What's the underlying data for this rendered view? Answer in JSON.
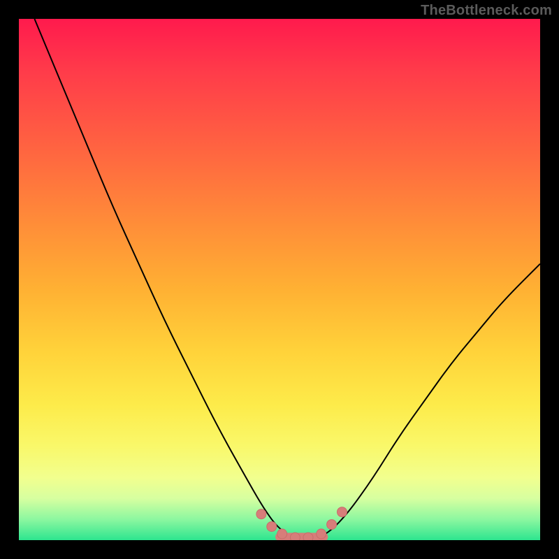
{
  "source_label": "TheBottleneck.com",
  "colors": {
    "curve_stroke": "#000000",
    "marker_fill": "#d77d7a",
    "marker_stroke": "#c96d6a"
  },
  "chart_data": {
    "type": "line",
    "title": "",
    "xlabel": "",
    "ylabel": "",
    "xlim": [
      0,
      1
    ],
    "ylim": [
      0,
      100
    ],
    "note": "y = bottleneck percentage; curve minimum (≈0% bottleneck) lies around x≈0.50–0.58; left branch starts near 100% at x≈0.03; right branch reaches ≈53% at x=1.0.",
    "series": [
      {
        "name": "bottleneck-curve",
        "x": [
          0.03,
          0.08,
          0.13,
          0.18,
          0.23,
          0.28,
          0.33,
          0.38,
          0.43,
          0.47,
          0.5,
          0.53,
          0.56,
          0.59,
          0.63,
          0.68,
          0.73,
          0.78,
          0.83,
          0.88,
          0.93,
          1.0
        ],
        "y": [
          100,
          88,
          76,
          64,
          53,
          42,
          32,
          22,
          13,
          6,
          2,
          0.5,
          0.3,
          1,
          5,
          12,
          20,
          27,
          34,
          40,
          46,
          53
        ]
      }
    ],
    "markers": {
      "name": "highlighted-points",
      "x": [
        0.465,
        0.485,
        0.505,
        0.53,
        0.555,
        0.58,
        0.6,
        0.62
      ],
      "y": [
        5.0,
        2.6,
        1.2,
        0.5,
        0.5,
        1.2,
        3.0,
        5.4
      ]
    },
    "marker_bar": {
      "x_start": 0.5,
      "x_end": 0.585,
      "y": 0.6,
      "thickness_pct": 1.6
    }
  }
}
